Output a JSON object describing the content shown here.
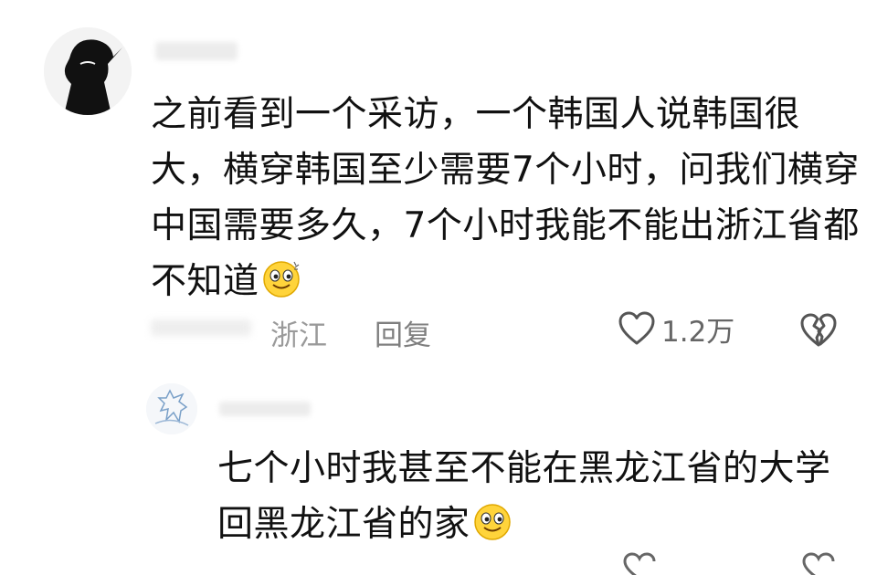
{
  "main_comment": {
    "avatar_icon": "silhouette-avatar-icon",
    "text": "之前看到一个采访，一个韩国人说韩国很大，横穿韩国至少需要7个小时，问我们横穿中国需要多久，7个小时我能不能出浙江省都不知道",
    "emoji_icon": "smirk-emoji-icon",
    "location": "浙江",
    "reply_label": "回复",
    "like_count": "1.2万",
    "like_icon": "heart-outline-icon",
    "dislike_icon": "broken-heart-icon"
  },
  "reply_comment": {
    "avatar_icon": "sketch-avatar-icon",
    "text": "七个小时我甚至不能在黑龙江省的大学回黑龙江省的家",
    "emoji_icon": "smirk-emoji-icon"
  },
  "colors": {
    "text": "#111111",
    "meta": "#8a8a8a",
    "emoji_face": "#ffd43b"
  }
}
